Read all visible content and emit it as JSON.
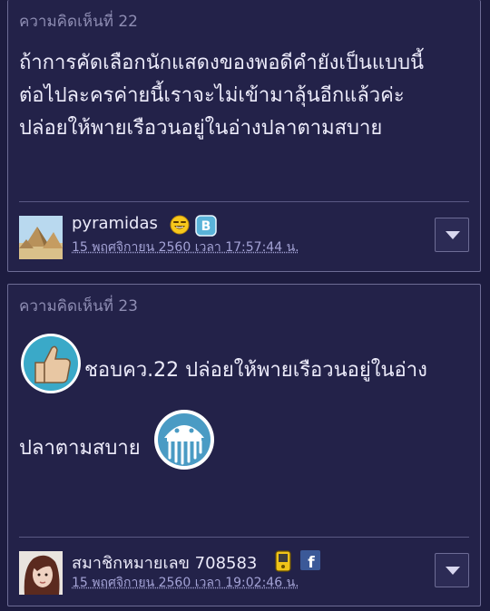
{
  "comments": [
    {
      "label": "ความคิดเห็นที่ 22",
      "text_lines": [
        "ถ้าการคัดเลือกนักแสดงของพอดีคำยังเป็นแบบนี้",
        "ต่อไปละครค่ายนี้เราจะไม่เข้ามาลุ้นอีกแล้วค่ะ",
        "ปล่อยให้พายเรือวนอยู่ในอ่างปลาตามสบาย"
      ],
      "author": "pyramidas",
      "timestamp": "15 พฤศจิกายน 2560 เวลา 17:57:44 น.",
      "badges": [
        "smiley-laugh-icon",
        "blog-b-icon"
      ]
    },
    {
      "label": "ความคิดเห็นที่ 23",
      "text_line1": "ชอบคว.22  ปล่อยให้พายเรือวนอยู่ในอ่าง",
      "text_line2": "ปลาตามสบาย",
      "stickers": [
        "thumbs-up-icon",
        "jellyfish-icon"
      ],
      "author": "สมาชิกหมายเลข 708583",
      "timestamp": "15 พฤศจิกายน 2560 เวลา 19:02:46 น.",
      "badges": [
        "phone-badge-icon",
        "facebook-icon"
      ]
    }
  ],
  "colors": {
    "background": "#1d1c40",
    "card": "#232249",
    "text": "#ecebfa",
    "muted": "#8e8db3",
    "link": "#a4a3d6"
  }
}
